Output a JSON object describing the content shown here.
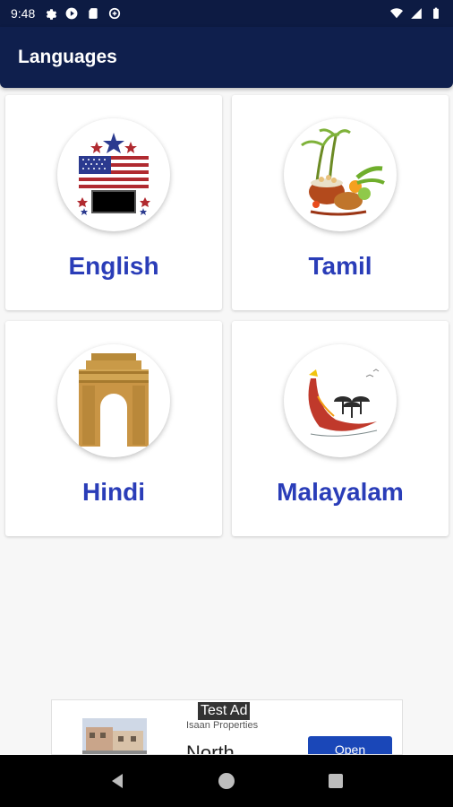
{
  "status_bar": {
    "time": "9:48",
    "icons_left": [
      "settings-icon",
      "play-protect-icon",
      "sd-card-icon",
      "data-saver-icon"
    ],
    "icons_right": [
      "wifi-icon",
      "signal-icon",
      "battery-icon"
    ]
  },
  "app_bar": {
    "title": "Languages",
    "color": "#0f1f4d"
  },
  "languages": [
    {
      "label": "English",
      "icon": "usa-flag-icon"
    },
    {
      "label": "Tamil",
      "icon": "pongal-harvest-icon"
    },
    {
      "label": "Hindi",
      "icon": "india-gate-icon"
    },
    {
      "label": "Malayalam",
      "icon": "snake-boat-icon"
    }
  ],
  "label_color": "#2a3db8",
  "ad": {
    "badge": "Test Ad",
    "advertiser": "Isaan Properties",
    "headline": "North",
    "button": "Open"
  },
  "nav": [
    "back-icon",
    "home-icon",
    "recents-icon"
  ]
}
